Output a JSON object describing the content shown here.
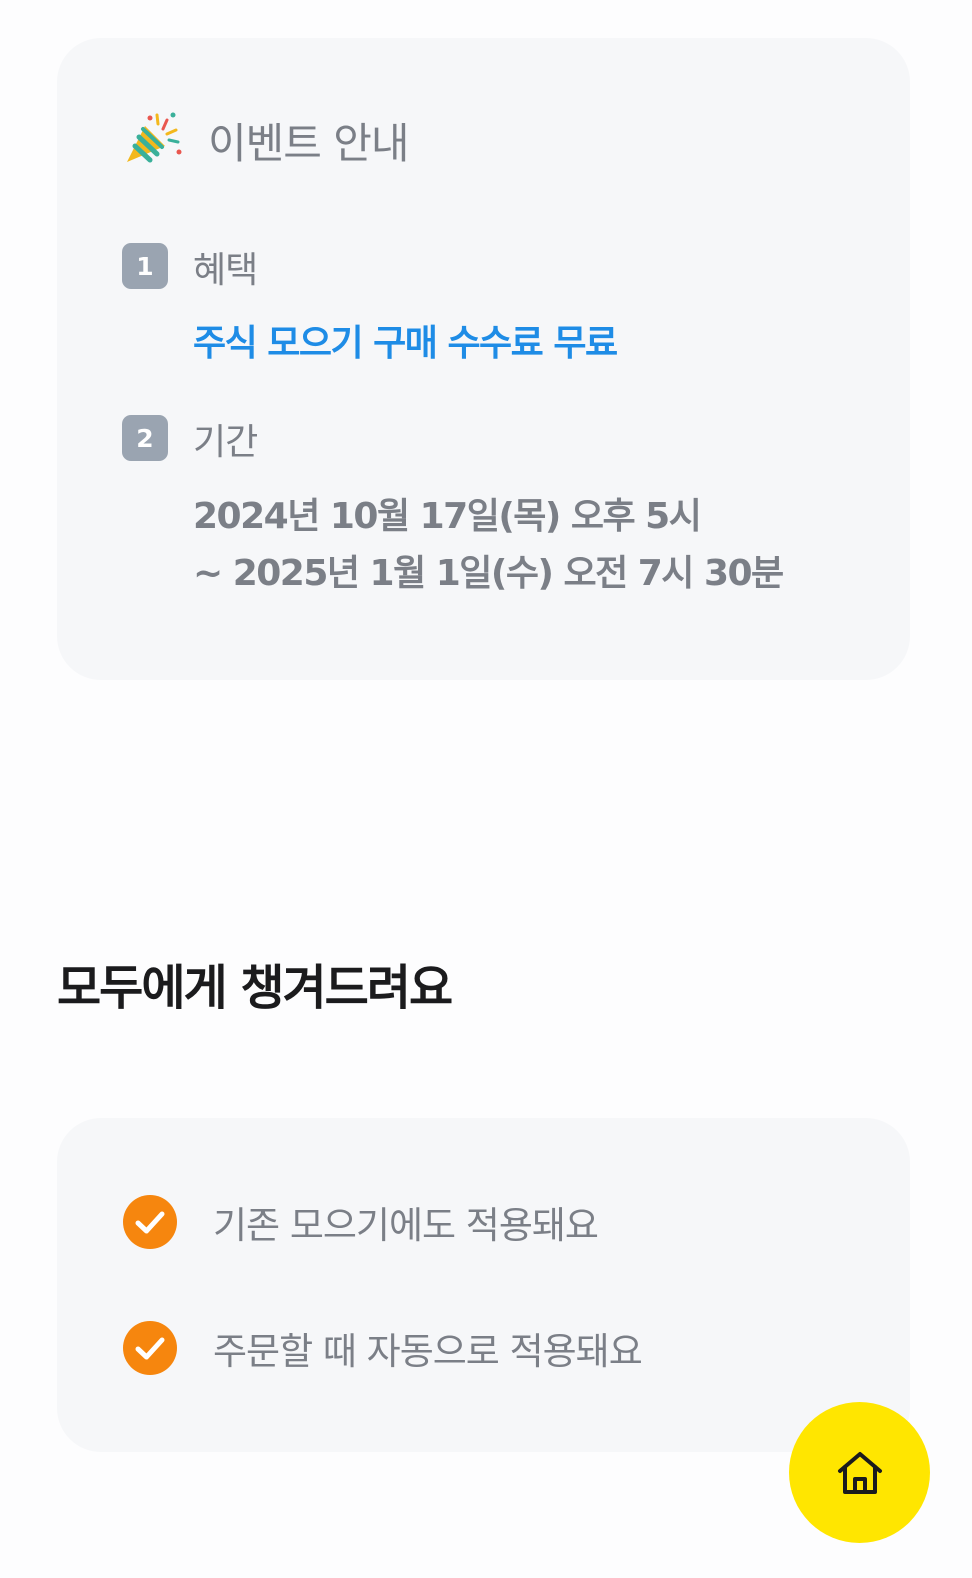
{
  "event_card": {
    "title": "이벤트 안내",
    "icon": "party-popper-icon",
    "items": [
      {
        "number": "1",
        "label": "혜택",
        "value": "주식 모으기 구매 수수료 무료"
      },
      {
        "number": "2",
        "label": "기간",
        "value_lines": [
          "2024년 10월 17일(목) 오후 5시",
          "~ 2025년 1월 1일(수) 오전 7시 30분"
        ]
      }
    ]
  },
  "section": {
    "heading": "모두에게 챙겨드려요"
  },
  "benefits_card": {
    "items": [
      {
        "icon": "check-circle-icon",
        "text": "기존 모으기에도 적용돼요"
      },
      {
        "icon": "check-circle-icon",
        "text": "주문할 때 자동으로 적용돼요"
      }
    ]
  },
  "home_button": {
    "icon": "home-icon"
  },
  "colors": {
    "card_bg": "#f6f7f9",
    "page_bg": "#fdfdfe",
    "accent_blue": "#1e8ce6",
    "check_orange": "#f6860e",
    "badge_gray": "#9aa4b1",
    "muted_text": "#7b7f87",
    "heading_text": "#1b1b1d",
    "home_yellow": "#ffe600"
  }
}
